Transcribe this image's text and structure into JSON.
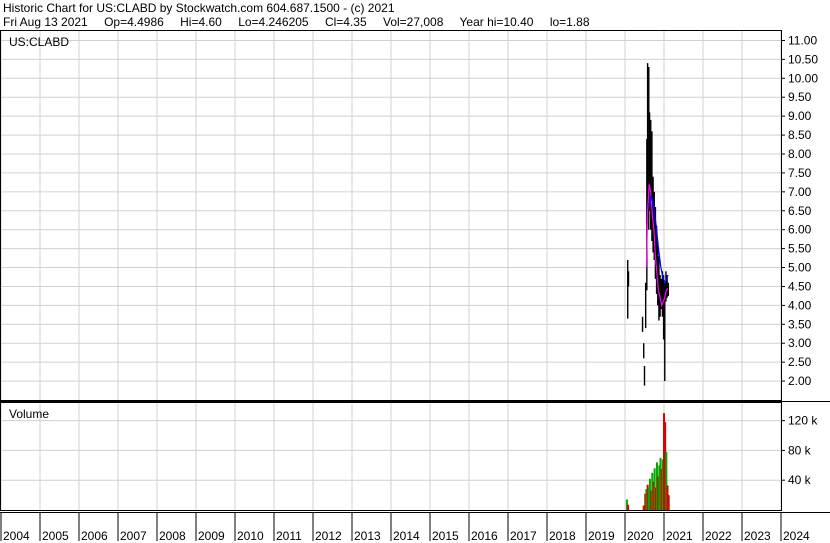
{
  "header": {
    "title": "Historic Chart for US:CLABD by Stockwatch.com 604.687.1500 - (c) 2021",
    "date": "Fri Aug 13 2021",
    "open": "Op=4.4986",
    "high": "Hi=4.60",
    "low": "Lo=4.246205",
    "close": "Cl=4.35",
    "volume": "Vol=27,008",
    "year_high": "Year hi=10.40",
    "year_low": "lo=1.88"
  },
  "chart_data": [
    {
      "type": "line",
      "title": "US:CLABD",
      "y_axis_side": "right",
      "ylim": [
        1.5,
        11.25
      ],
      "y_ticks": [
        "11.00",
        "10.50",
        "10.00",
        "9.50",
        "9.00",
        "8.50",
        "8.00",
        "7.50",
        "7.00",
        "6.50",
        "6.00",
        "5.50",
        "5.00",
        "4.50",
        "4.00",
        "3.50",
        "3.00",
        "2.50",
        "2.00"
      ],
      "x_ticks": [
        "2004",
        "2005",
        "2006",
        "2007",
        "2008",
        "2009",
        "2010",
        "2011",
        "2012",
        "2013",
        "2014",
        "2015",
        "2016",
        "2017",
        "2018",
        "2019",
        "2020",
        "2021",
        "2022",
        "2023",
        "2024"
      ],
      "xlim": [
        2004.0,
        2024.0
      ],
      "grid": true,
      "colors": {
        "price": "#000000",
        "ma_short": "#ff00ff",
        "ma_long": "#0000ff",
        "grid": "#d0d0d0"
      },
      "price_bars": [
        {
          "x": 2020.07,
          "high": 5.2,
          "low": 3.65
        },
        {
          "x": 2020.09,
          "high": 4.9,
          "low": 4.5
        },
        {
          "x": 2020.45,
          "high": 3.7,
          "low": 3.3
        },
        {
          "x": 2020.48,
          "high": 3.0,
          "low": 2.6
        },
        {
          "x": 2020.5,
          "high": 2.4,
          "low": 1.88
        },
        {
          "x": 2020.53,
          "high": 4.6,
          "low": 3.4
        },
        {
          "x": 2020.56,
          "high": 8.4,
          "low": 4.4
        },
        {
          "x": 2020.58,
          "high": 10.4,
          "low": 6.3
        },
        {
          "x": 2020.61,
          "high": 10.3,
          "low": 6.0
        },
        {
          "x": 2020.63,
          "high": 9.1,
          "low": 6.5
        },
        {
          "x": 2020.66,
          "high": 8.9,
          "low": 6.0
        },
        {
          "x": 2020.69,
          "high": 8.6,
          "low": 5.7
        },
        {
          "x": 2020.72,
          "high": 7.4,
          "low": 5.4
        },
        {
          "x": 2020.75,
          "high": 7.0,
          "low": 5.2
        },
        {
          "x": 2020.78,
          "high": 6.6,
          "low": 4.7
        },
        {
          "x": 2020.81,
          "high": 6.1,
          "low": 4.3
        },
        {
          "x": 2020.84,
          "high": 5.7,
          "low": 4.0
        },
        {
          "x": 2020.87,
          "high": 5.3,
          "low": 3.6
        },
        {
          "x": 2020.9,
          "high": 4.8,
          "low": 3.7
        },
        {
          "x": 2020.93,
          "high": 4.7,
          "low": 3.9
        },
        {
          "x": 2020.96,
          "high": 4.9,
          "low": 3.7
        },
        {
          "x": 2020.99,
          "high": 4.8,
          "low": 3.1
        },
        {
          "x": 2021.02,
          "high": 4.6,
          "low": 2.0
        },
        {
          "x": 2021.05,
          "high": 4.9,
          "low": 4.1
        },
        {
          "x": 2021.08,
          "high": 4.8,
          "low": 4.2
        },
        {
          "x": 2021.11,
          "high": 4.6,
          "low": 4.25
        }
      ],
      "ma_short": [
        {
          "x": 2020.55,
          "y": 5.0
        },
        {
          "x": 2020.58,
          "y": 6.5
        },
        {
          "x": 2020.62,
          "y": 7.2
        },
        {
          "x": 2020.66,
          "y": 7.0
        },
        {
          "x": 2020.7,
          "y": 6.4
        },
        {
          "x": 2020.74,
          "y": 6.0
        },
        {
          "x": 2020.78,
          "y": 5.3
        },
        {
          "x": 2020.82,
          "y": 4.8
        },
        {
          "x": 2020.86,
          "y": 4.4
        },
        {
          "x": 2020.9,
          "y": 4.2
        },
        {
          "x": 2020.94,
          "y": 4.0
        },
        {
          "x": 2020.98,
          "y": 4.1
        },
        {
          "x": 2021.02,
          "y": 4.2
        },
        {
          "x": 2021.06,
          "y": 4.4
        },
        {
          "x": 2021.1,
          "y": 4.45
        }
      ],
      "ma_long": [
        {
          "x": 2020.62,
          "y": 6.6
        },
        {
          "x": 2020.68,
          "y": 6.9
        },
        {
          "x": 2020.74,
          "y": 6.6
        },
        {
          "x": 2020.8,
          "y": 6.1
        },
        {
          "x": 2020.86,
          "y": 5.5
        },
        {
          "x": 2020.92,
          "y": 5.0
        },
        {
          "x": 2020.98,
          "y": 4.7
        },
        {
          "x": 2021.04,
          "y": 4.6
        },
        {
          "x": 2021.1,
          "y": 4.8
        }
      ]
    },
    {
      "type": "bar",
      "title": "Volume",
      "ylim": [
        0,
        145000
      ],
      "y_ticks": [
        {
          "value": 40000,
          "label": "40 k"
        },
        {
          "value": 80000,
          "label": "80 k"
        },
        {
          "value": 120000,
          "label": "120 k"
        }
      ],
      "colors": {
        "up": "#00aa00",
        "down": "#dd0000"
      },
      "bars": [
        {
          "x": 2020.05,
          "v": 14000,
          "c": "up"
        },
        {
          "x": 2020.08,
          "v": 7000,
          "c": "down"
        },
        {
          "x": 2020.48,
          "v": 6000,
          "c": "down"
        },
        {
          "x": 2020.52,
          "v": 22000,
          "c": "down"
        },
        {
          "x": 2020.55,
          "v": 28000,
          "c": "up"
        },
        {
          "x": 2020.58,
          "v": 34000,
          "c": "down"
        },
        {
          "x": 2020.61,
          "v": 30000,
          "c": "up"
        },
        {
          "x": 2020.64,
          "v": 42000,
          "c": "up"
        },
        {
          "x": 2020.67,
          "v": 26000,
          "c": "down"
        },
        {
          "x": 2020.7,
          "v": 50000,
          "c": "up"
        },
        {
          "x": 2020.73,
          "v": 38000,
          "c": "down"
        },
        {
          "x": 2020.76,
          "v": 56000,
          "c": "up"
        },
        {
          "x": 2020.79,
          "v": 30000,
          "c": "down"
        },
        {
          "x": 2020.82,
          "v": 64000,
          "c": "up"
        },
        {
          "x": 2020.85,
          "v": 45000,
          "c": "down"
        },
        {
          "x": 2020.88,
          "v": 60000,
          "c": "up"
        },
        {
          "x": 2020.91,
          "v": 70000,
          "c": "up"
        },
        {
          "x": 2020.94,
          "v": 55000,
          "c": "down"
        },
        {
          "x": 2020.97,
          "v": 68000,
          "c": "up"
        },
        {
          "x": 2021.0,
          "v": 130000,
          "c": "down"
        },
        {
          "x": 2021.03,
          "v": 118000,
          "c": "down"
        },
        {
          "x": 2021.06,
          "v": 78000,
          "c": "up"
        },
        {
          "x": 2021.09,
          "v": 33000,
          "c": "down"
        },
        {
          "x": 2021.12,
          "v": 20000,
          "c": "down"
        }
      ]
    }
  ]
}
